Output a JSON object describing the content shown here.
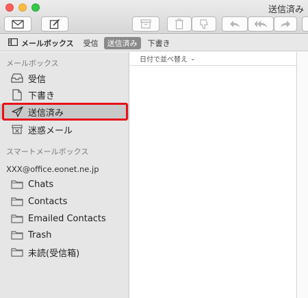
{
  "window": {
    "title": "送信済み"
  },
  "favorites_bar": {
    "mailboxes_label": "メールボックス",
    "items": [
      {
        "label": "受信",
        "selected": false
      },
      {
        "label": "送信済み",
        "selected": true
      },
      {
        "label": "下書き",
        "selected": false
      }
    ]
  },
  "sidebar": {
    "mailboxes_header": "メールボックス",
    "mailboxes": [
      {
        "label": "受信",
        "icon": "inbox-icon"
      },
      {
        "label": "下書き",
        "icon": "draft-icon"
      },
      {
        "label": "送信済み",
        "icon": "paper-plane-icon",
        "selected": true
      },
      {
        "label": "迷惑メール",
        "icon": "junk-icon"
      }
    ],
    "smart_header": "スマートメールボックス",
    "account": "XXX@office.eonet.ne.jp",
    "folders": [
      {
        "label": "Chats",
        "icon": "folder-icon"
      },
      {
        "label": "Contacts",
        "icon": "folder-icon"
      },
      {
        "label": "Emailed Contacts",
        "icon": "folder-icon"
      },
      {
        "label": "Trash",
        "icon": "folder-icon"
      },
      {
        "label": "未読(受信箱)",
        "icon": "folder-icon"
      }
    ]
  },
  "message_list": {
    "sort_label": "日付で並べ替え"
  },
  "colors": {
    "highlight": "#e8101a",
    "selected_row": "#c9c9c9",
    "sidebar_bg": "#e6e6e6"
  }
}
